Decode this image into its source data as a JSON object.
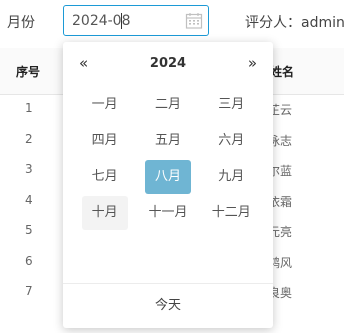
{
  "filter": {
    "label": "月份",
    "value": "2024-08",
    "icon": "calendar-icon"
  },
  "reviewer": {
    "text": "评分人：admin"
  },
  "table": {
    "columns": {
      "seq": "序号",
      "name": "姓名"
    },
    "rows": [
      {
        "seq": "1",
        "name": "吴芷云"
      },
      {
        "seq": "2",
        "name": "余咏志"
      },
      {
        "seq": "3",
        "name": "侯尔蓝"
      },
      {
        "seq": "4",
        "name": "姚依霜"
      },
      {
        "seq": "5",
        "name": "尹元亮"
      },
      {
        "seq": "6",
        "name": "苏鸿风"
      },
      {
        "seq": "7",
        "name": "孙良奥"
      }
    ]
  },
  "picker": {
    "prev": "«",
    "next": "»",
    "year": "2024",
    "months": [
      "一月",
      "二月",
      "三月",
      "四月",
      "五月",
      "六月",
      "七月",
      "八月",
      "九月",
      "十月",
      "十一月",
      "十二月"
    ],
    "selected_index": 7,
    "hover_index": 9,
    "selected_color": "#6fb5d3",
    "today_label": "今天"
  }
}
